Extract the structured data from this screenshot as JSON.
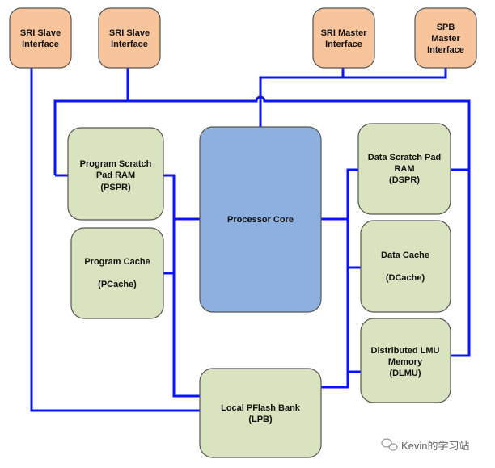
{
  "blocks": {
    "sri_slave_1": [
      "SRI Slave",
      "Interface"
    ],
    "sri_slave_2": [
      "SRI Slave",
      "Interface"
    ],
    "sri_master": [
      "SRI Master",
      "Interface"
    ],
    "spb_master": [
      "SPB",
      "Master",
      "Interface"
    ],
    "pspr": [
      "Program Scratch",
      "Pad RAM",
      "(PSPR)"
    ],
    "pcache": [
      "Program Cache",
      "(PCache)"
    ],
    "core": [
      "Processor Core"
    ],
    "dspr": [
      "Data Scratch Pad",
      "RAM",
      "(DSPR)"
    ],
    "dcache": [
      "Data Cache",
      "(DCache)"
    ],
    "dlmu": [
      "Distributed LMU",
      "Memory",
      "(DLMU)"
    ],
    "lpb": [
      "Local PFlash Bank",
      "(LPB)"
    ]
  },
  "watermark": "Kevin的学习站",
  "colors": {
    "interface": "#f8c49b",
    "memory": "#d9e3bf",
    "core": "#8db0e0",
    "bus": "#0a14ff"
  }
}
